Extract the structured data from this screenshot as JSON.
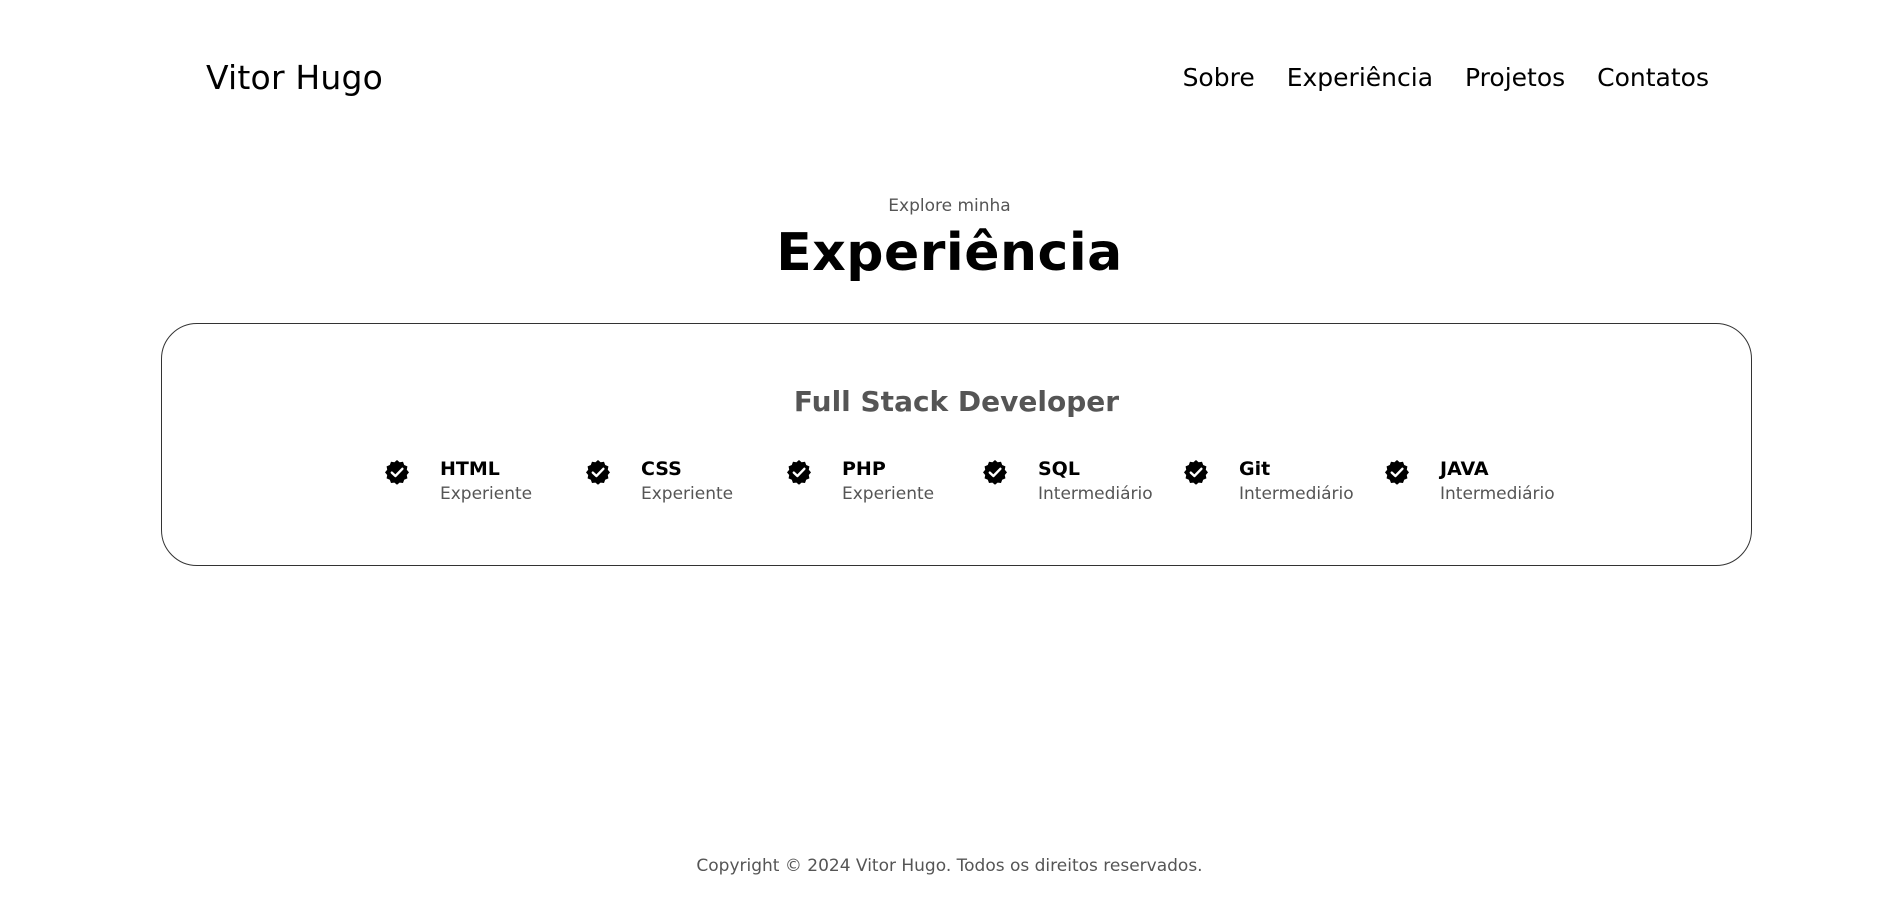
{
  "header": {
    "logo": "Vitor Hugo",
    "nav": [
      {
        "label": "Sobre"
      },
      {
        "label": "Experiência"
      },
      {
        "label": "Projetos"
      },
      {
        "label": "Contatos"
      }
    ]
  },
  "experience": {
    "subtitle": "Explore minha",
    "title": "Experiência",
    "card": {
      "title": "Full Stack Developer",
      "skills": [
        {
          "name": "HTML",
          "level": "Experiente",
          "icon": "checkmark-badge-icon"
        },
        {
          "name": "CSS",
          "level": "Experiente",
          "icon": "checkmark-badge-icon"
        },
        {
          "name": "PHP",
          "level": "Experiente",
          "icon": "checkmark-badge-icon"
        },
        {
          "name": "SQL",
          "level": "Intermediário",
          "icon": "checkmark-badge-icon"
        },
        {
          "name": "Git",
          "level": "Intermediário",
          "icon": "checkmark-badge-icon"
        },
        {
          "name": "JAVA",
          "level": "Intermediário",
          "icon": "checkmark-badge-icon"
        }
      ]
    }
  },
  "footer": {
    "copyright": "Copyright © 2024 Vitor Hugo. Todos os direitos reservados."
  },
  "colors": {
    "text": "#000000",
    "muted": "#555555",
    "border": "#333333",
    "background": "#ffffff"
  }
}
